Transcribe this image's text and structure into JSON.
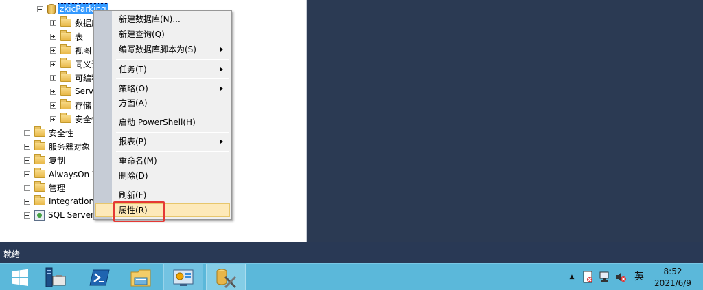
{
  "tree": {
    "db_name": "zkicParking",
    "db_children": [
      {
        "label": "数据库"
      },
      {
        "label": "表"
      },
      {
        "label": "视图"
      },
      {
        "label": "同义词"
      },
      {
        "label": "可编程"
      },
      {
        "label": "Service"
      },
      {
        "label": "存储"
      },
      {
        "label": "安全性"
      }
    ],
    "top_level": [
      {
        "label": "安全性"
      },
      {
        "label": "服务器对象"
      },
      {
        "label": "复制"
      },
      {
        "label": "AlwaysOn 高"
      },
      {
        "label": "管理"
      },
      {
        "label": "Integration"
      },
      {
        "label": "SQL Server"
      }
    ]
  },
  "context_menu": {
    "items": [
      {
        "label": "新建数据库(N)..."
      },
      {
        "label": "新建查询(Q)"
      },
      {
        "label": "编写数据库脚本为(S)"
      },
      {
        "label": "任务(T)"
      },
      {
        "label": "策略(O)"
      },
      {
        "label": "方面(A)"
      },
      {
        "label": "启动 PowerShell(H)"
      },
      {
        "label": "报表(P)"
      },
      {
        "label": "重命名(M)"
      },
      {
        "label": "删除(D)"
      },
      {
        "label": "刷新(F)"
      },
      {
        "label": "属性(R)"
      }
    ],
    "highlighted_item": "属性(R)"
  },
  "status_bar": {
    "text": "就绪"
  },
  "taskbar": {
    "apps": [
      {
        "icon": "windows-start-icon"
      },
      {
        "icon": "server-manager-icon"
      },
      {
        "icon": "powershell-icon"
      },
      {
        "icon": "file-explorer-icon"
      },
      {
        "icon": "control-panel-icon"
      },
      {
        "icon": "ssms-icon"
      }
    ],
    "tray": {
      "ime": "英",
      "time": "8:52",
      "date": "2021/6/9"
    }
  },
  "colors": {
    "selection": "#3399ff",
    "highlight_box": "#e53935",
    "taskbar": "#5bb8da",
    "status_bar": "#293955"
  }
}
